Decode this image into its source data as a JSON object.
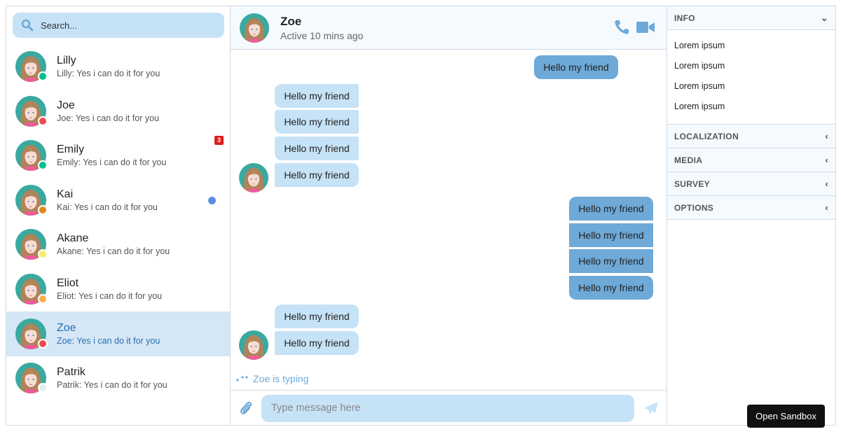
{
  "search": {
    "placeholder": "Search..."
  },
  "conversations": [
    {
      "name": "Lilly",
      "preview": "Lilly: Yes i can do it for you",
      "status_color": "#00bf8f"
    },
    {
      "name": "Joe",
      "preview": "Joe: Yes i can do it for you",
      "status_color": "#ef4d4d"
    },
    {
      "name": "Emily",
      "preview": "Emily: Yes i can do it for you",
      "status_color": "#00bf8f",
      "unread": "3"
    },
    {
      "name": "Kai",
      "preview": "Kai: Yes i can do it for you",
      "status_color": "#e0871a",
      "unread_dot": true
    },
    {
      "name": "Akane",
      "preview": "Akane: Yes i can do it for you",
      "status_color": "#f5ef6a"
    },
    {
      "name": "Eliot",
      "preview": "Eliot: Yes i can do it for you",
      "status_color": "#fdad45"
    },
    {
      "name": "Zoe",
      "preview": "Zoe: Yes i can do it for you",
      "status_color": "#ef4d4d",
      "selected": true
    },
    {
      "name": "Patrik",
      "preview": "Patrik: Yes i can do it for you",
      "status_color": "#e6eef3"
    }
  ],
  "chat": {
    "name": "Zoe",
    "status": "Active 10 mins ago",
    "messages": [
      "Hello my friend",
      "Hello my friend",
      "Hello my friend",
      "Hello my friend",
      "Hello my friend",
      "Hello my friend",
      "Hello my friend",
      "Hello my friend",
      "Hello my friend",
      "Hello my friend",
      "Hello my friend"
    ],
    "typing": "Zoe is typing",
    "input_placeholder": "Type message here"
  },
  "sidebar": {
    "info_title": "INFO",
    "info_items": [
      "Lorem ipsum",
      "Lorem ipsum",
      "Lorem ipsum",
      "Lorem ipsum"
    ],
    "sections": [
      "LOCALIZATION",
      "MEDIA",
      "SURVEY",
      "OPTIONS"
    ]
  },
  "sandbox_button": "Open Sandbox",
  "colors": {
    "accent": "#6ea9d7",
    "light": "#c6e2f7",
    "selected": "#d5e7f6"
  }
}
